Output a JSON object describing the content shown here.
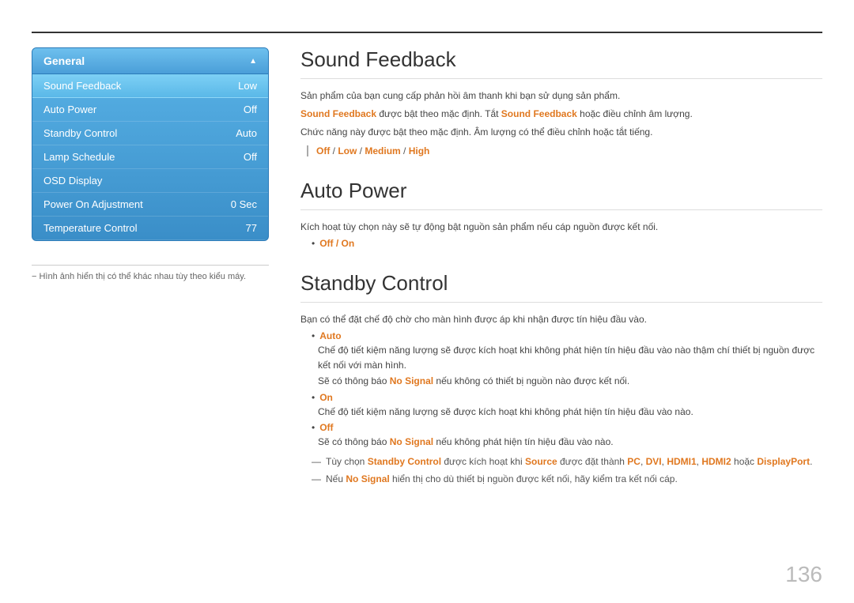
{
  "topLine": true,
  "sidebar": {
    "header": "General",
    "items": [
      {
        "label": "Sound Feedback",
        "value": "Low",
        "active": true
      },
      {
        "label": "Auto Power",
        "value": "Off",
        "active": false
      },
      {
        "label": "Standby Control",
        "value": "Auto",
        "active": false
      },
      {
        "label": "Lamp Schedule",
        "value": "Off",
        "active": false
      },
      {
        "label": "OSD Display",
        "value": "",
        "active": false
      },
      {
        "label": "Power On Adjustment",
        "value": "0 Sec",
        "active": false
      },
      {
        "label": "Temperature Control",
        "value": "77",
        "active": false
      }
    ],
    "note": "− Hình ảnh hiển thị có thể khác nhau tùy theo kiểu máy."
  },
  "sections": [
    {
      "id": "sound-feedback",
      "title": "Sound Feedback",
      "paragraphs": [
        "Sản phẩm của bạn cung cấp phản hồi âm thanh khi bạn sử dụng sản phẩm.",
        {
          "parts": [
            "",
            "Sound Feedback",
            " được bật theo mặc định. Tắt ",
            "Sound Feedback",
            " hoặc điều chỉnh âm lượng."
          ]
        },
        "Chức năng này được bật theo mặc định. Âm lượng có thể điều chỉnh hoặc tắt tiếng."
      ],
      "optionsLine": "Off / Low / Medium / High",
      "optionsHighlight": [
        "Off",
        "Low",
        "Medium",
        "High"
      ]
    },
    {
      "id": "auto-power",
      "title": "Auto Power",
      "paragraphs": [
        "Kích hoạt tùy chọn này sẽ tự động bật nguồn sản phẩm nếu cáp nguồn được kết nối."
      ],
      "bullet": {
        "label": "Off / On",
        "highlight": true
      }
    },
    {
      "id": "standby-control",
      "title": "Standby Control",
      "paragraphs": [
        "Bạn có thể đặt chế độ chờ cho màn hình được áp khi nhận được tín hiệu đầu vào."
      ],
      "bullets": [
        {
          "label": "Auto",
          "highlight": true,
          "subs": [
            "Chế độ tiết kiệm năng lượng sẽ được kích hoạt khi không phát hiện tín hiệu đầu vào nào thậm chí thiết bị nguồn được kết nối với màn hình.",
            {
              "text": "Sẽ có thông báo ",
              "highlight": "No Signal",
              "rest": " nếu không có thiết bị nguồn nào được kết nối."
            }
          ]
        },
        {
          "label": "On",
          "highlight": true,
          "subs": [
            "Chế độ tiết kiệm năng lượng sẽ được kích hoạt khi không phát hiện tín hiệu đầu vào nào."
          ]
        },
        {
          "label": "Off",
          "highlight": true,
          "subs": [
            {
              "text": "Sẽ có thông báo ",
              "highlight": "No Signal",
              "rest": " nếu không phát hiện tín hiệu đầu vào nào."
            }
          ]
        }
      ],
      "dashNotes": [
        {
          "parts": [
            "Tùy chọn ",
            "Standby Control",
            " được kích hoạt khi ",
            "Source",
            " được đặt thành ",
            "PC",
            ", ",
            "DVI",
            ", ",
            "HDMI1",
            ", ",
            "HDMI2",
            " hoặc ",
            "DisplayPort",
            "."
          ]
        },
        {
          "parts": [
            "Nếu ",
            "No Signal",
            " hiển thị cho dù thiết bị nguồn được kết nối, hãy kiểm tra kết nối cáp."
          ]
        }
      ]
    }
  ],
  "pageNumber": "136"
}
